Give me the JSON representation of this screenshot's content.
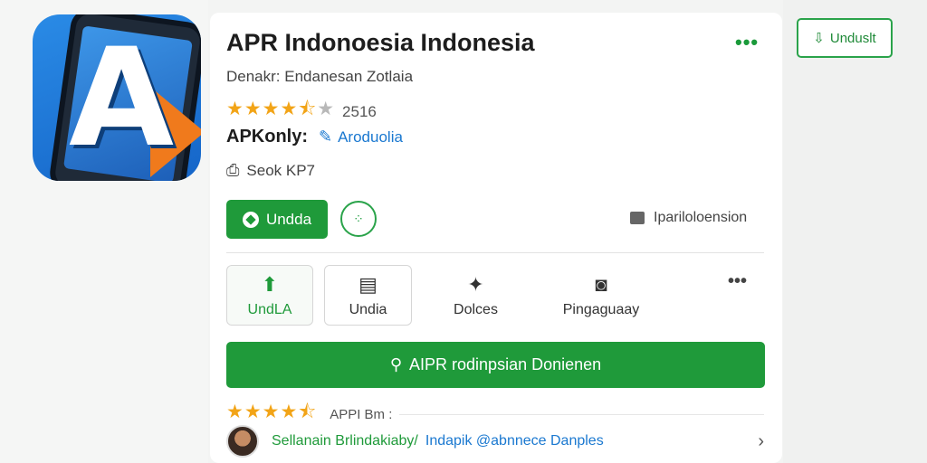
{
  "app": {
    "title": "APR Indonoesia Indonesia",
    "subtitle": "Denakr: Endanesan Zotlaia",
    "rating_stars": "★★★★",
    "rating_half": "⯪",
    "rating_empty": "★",
    "rating_count": "2516",
    "developer": "APKonly:",
    "developer_link": "Aroduolia",
    "size": "Seok KP7"
  },
  "actions": {
    "install_label": "Undda",
    "report_label": "Ipariloloension"
  },
  "tabs": [
    {
      "label": "UndLA",
      "icon": "⬆"
    },
    {
      "label": "Undia",
      "icon": "▤"
    },
    {
      "label": "Dolces",
      "icon": "✦"
    },
    {
      "label": "Pingaguaay",
      "icon": "◙"
    }
  ],
  "search_button": {
    "label": "AIPR rodinpsian Donienen"
  },
  "review_section": {
    "stars": "★★★★",
    "half": "⯪",
    "label": "APPI Bm :"
  },
  "review": {
    "name": "Sellanain Brlindakiaby/",
    "text": "Indapik @abnnece Danples"
  },
  "side_button": {
    "label": "Unduslt"
  },
  "icons": {
    "more_top": "•••",
    "more_tabs": "•••",
    "chevron": "›",
    "share": "⎙",
    "pen": "✎",
    "search": "⚲"
  },
  "colors": {
    "brand_green": "#1f9a3a",
    "link_blue": "#1a78d0",
    "star_gold": "#f2a417"
  }
}
